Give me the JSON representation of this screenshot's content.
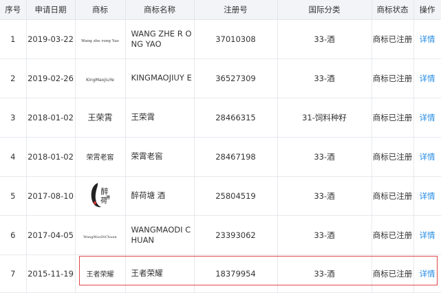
{
  "headers": [
    "序号",
    "申请日期",
    "商标",
    "商标名称",
    "注册号",
    "国际分类",
    "商标状态",
    "操作"
  ],
  "rows": [
    {
      "index": "1",
      "date": "2019-03-22",
      "logo_text": "Wang zhe rong Yao",
      "name": "WANG ZHE R ONG YAO",
      "reg_no": "37010308",
      "class": "33-酒",
      "status": "商标已注册",
      "action": "详情"
    },
    {
      "index": "2",
      "date": "2019-02-26",
      "logo_text": "KingMaoJiuYe",
      "name": "KINGMAOJIUY E",
      "reg_no": "36527309",
      "class": "33-酒",
      "status": "商标已注册",
      "action": "详情"
    },
    {
      "index": "3",
      "date": "2018-01-02",
      "logo_text": "王荣霄",
      "name": "王荣霄",
      "reg_no": "28466315",
      "class": "31-饲料种籽",
      "status": "商标已注册",
      "action": "详情"
    },
    {
      "index": "4",
      "date": "2018-01-02",
      "logo_text": "荣霄老窖",
      "name": "荣霄老窖",
      "reg_no": "28467198",
      "class": "33-酒",
      "status": "商标已注册",
      "action": "详情"
    },
    {
      "index": "5",
      "date": "2017-08-10",
      "logo_text": "醉荷塘",
      "name": "醉荷塘 酒",
      "reg_no": "25804519",
      "class": "33-酒",
      "status": "商标已注册",
      "action": "详情"
    },
    {
      "index": "6",
      "date": "2017-04-05",
      "logo_text": "WangMaoDiChuan",
      "name": "WANGMAODI CHUAN",
      "reg_no": "23393062",
      "class": "33-酒",
      "status": "商标已注册",
      "action": "详情"
    },
    {
      "index": "7",
      "date": "2015-11-19",
      "logo_text": "王者荣耀",
      "name": "王者荣耀",
      "reg_no": "18379954",
      "class": "33-酒",
      "status": "商标已注册",
      "action": "详情"
    }
  ],
  "colors": {
    "header_bg": "#f2f4f7",
    "link": "#1e88e5",
    "highlight": "#e04848"
  }
}
